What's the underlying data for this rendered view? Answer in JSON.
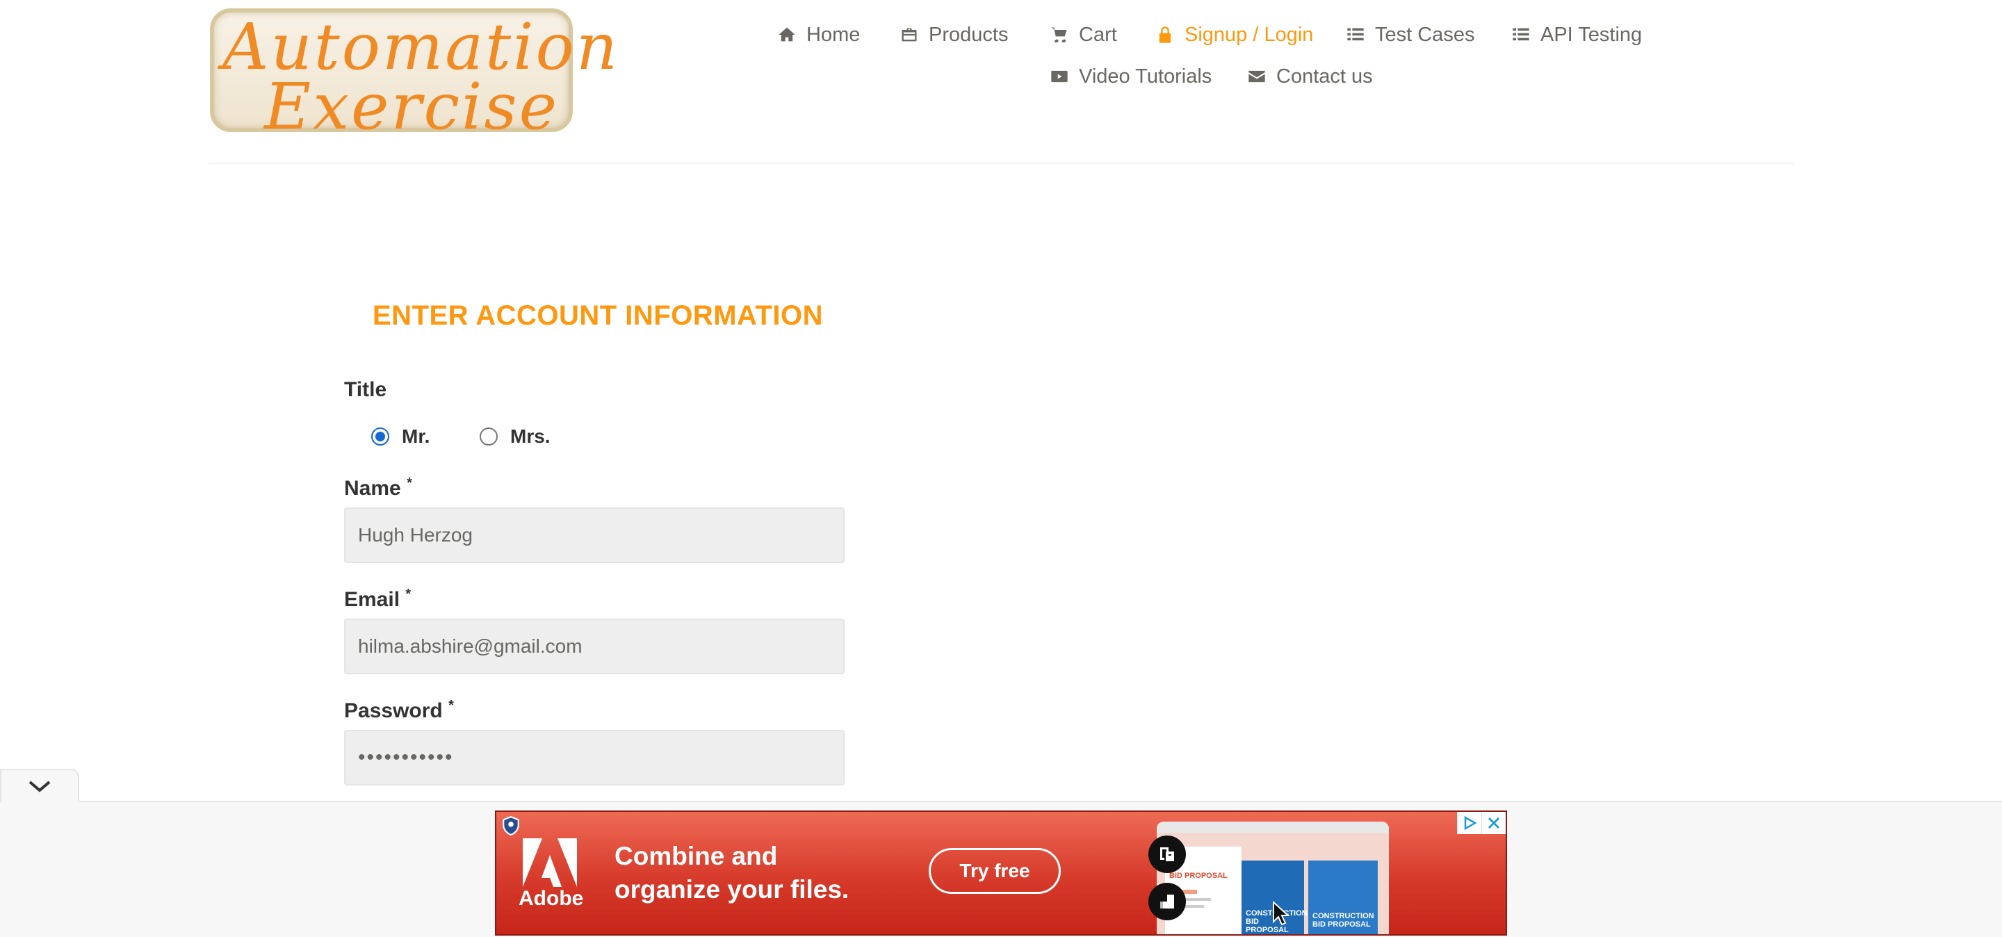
{
  "logo": {
    "line1": "Automation",
    "line2": "Exercise"
  },
  "nav": [
    {
      "label": "Home",
      "icon": "home-icon"
    },
    {
      "label": "Products",
      "icon": "products-icon"
    },
    {
      "label": "Cart",
      "icon": "cart-icon"
    },
    {
      "label": "Signup / Login",
      "icon": "lock-icon",
      "active": true
    },
    {
      "label": "Test Cases",
      "icon": "list-icon"
    },
    {
      "label": "API Testing",
      "icon": "list-icon"
    },
    {
      "label": "Video Tutorials",
      "icon": "youtube-icon"
    },
    {
      "label": "Contact us",
      "icon": "envelope-icon"
    }
  ],
  "form": {
    "title": "ENTER ACCOUNT INFORMATION",
    "title_label": "Title",
    "radio_mr": "Mr.",
    "radio_mrs": "Mrs.",
    "selected_title": "Mr.",
    "name_label": "Name",
    "name_value": "Hugh Herzog",
    "email_label": "Email",
    "email_value": "hilma.abshire@gmail.com",
    "password_label": "Password",
    "password_value": "•••••••••••",
    "required_mark": "*"
  },
  "ad": {
    "brand": "Adobe",
    "headline_line1": "Combine and",
    "headline_line2": "organize your files.",
    "cta": "Try free",
    "preview_label1": "BID PROPOSAL",
    "preview_label2": "CONSTRUCTION BID PROPOSAL",
    "preview_label3": "CONSTRUCTION BID PROPOSAL"
  },
  "colors": {
    "accent": "#fe980f",
    "text": "#696763",
    "ad_red": "#d63a2a",
    "radio_blue": "#1668d6"
  }
}
